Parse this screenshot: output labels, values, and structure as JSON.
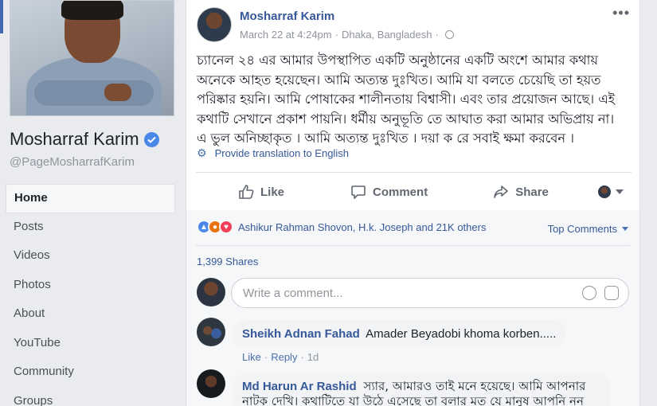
{
  "page": {
    "name": "Mosharraf Karim",
    "handle": "@PageMosharrafKarim",
    "nav": [
      "Home",
      "Posts",
      "Videos",
      "Photos",
      "About",
      "YouTube",
      "Community",
      "Groups"
    ]
  },
  "post": {
    "author": "Mosharraf Karim",
    "date": "March 22 at 4:24pm",
    "separator": "·",
    "location": "Dhaka, Bangladesh",
    "text": "চ্যানেল ২৪ এর আমার উপস্থাপিত একটি অনুষ্ঠানের একটি অংশে আমার কথায় অনেকে আহত হয়েছেন। আমি অত্যন্ত দুঃখিত। আমি যা বলতে চেয়েছি তা হয়ত পরিষ্কার হয়নি। আমি পোষাকের শালীনতায় বিশ্বাসী। এবং তার প্রয়োজন আছে। এই কথাটি সেখানে প্রকাশ পায়নি। ধর্মীয় অনুভূতি তে আঘাত করা আমার অভিপ্রায় না। এ ভুল অনিচ্ছাকৃত । আমি অত্যন্ত দুঃখিত । দয়া ক রে সবাই ক্ষমা করবেন ।",
    "translate": "Provide translation to English",
    "actions": {
      "like": "Like",
      "comment": "Comment",
      "share": "Share"
    }
  },
  "feedback": {
    "reactors": "Ashikur Rahman Shovon, H.k. Joseph and 21K others",
    "top_comments": "Top Comments",
    "shares": "1,399 Shares",
    "comment_placeholder": "Write a comment...",
    "comments": [
      {
        "author": "Sheikh Adnan Fahad",
        "text": "Amader Beyadobi khoma korben.....",
        "like": "Like",
        "reply": "Reply",
        "time": "1d",
        "dot": "·"
      },
      {
        "author": "Md Harun Ar Rashid",
        "text": "স্যার, আমারও তাই মনে হয়েছে। আমি আপনার নাটক দেখি। কথাটিতে যা উঠে এসেছে তা বলার মত যে মানুষ আপনি নন"
      }
    ]
  },
  "colors": {
    "link": "#365899",
    "accent": "#4267b2",
    "verified": "#4a88e8"
  },
  "icons": [
    "verified-badge-icon",
    "globe-icon",
    "more-options-icon",
    "gear-icon",
    "like-icon",
    "comment-icon",
    "share-icon",
    "emoji-icon",
    "sticker-icon"
  ]
}
